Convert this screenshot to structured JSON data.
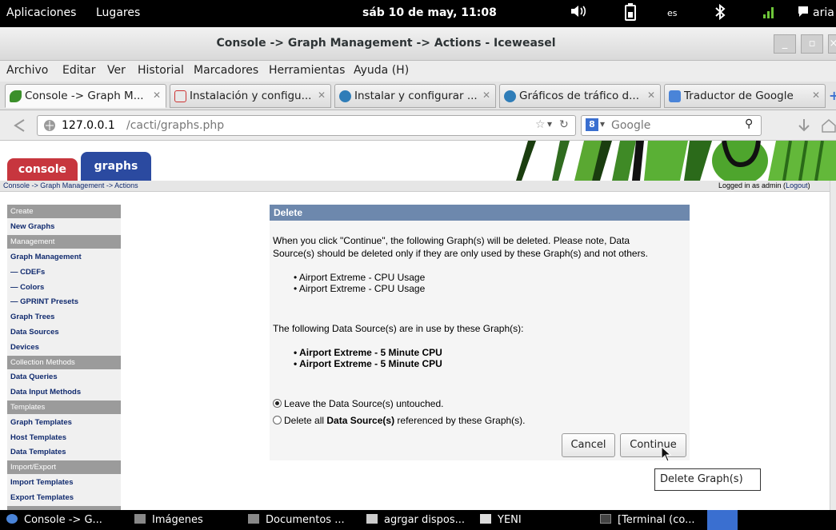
{
  "topbar": {
    "applications": "Aplicaciones",
    "places": "Lugares",
    "clock": "sáb 10 de may, 11:08",
    "lang": "es",
    "user": "aria"
  },
  "window": {
    "title": "Console -> Graph Management -> Actions - Iceweasel"
  },
  "menu": {
    "items": [
      "Archivo",
      "Editar",
      "Ver",
      "Historial",
      "Marcadores",
      "Herramientas",
      "Ayuda (H)"
    ]
  },
  "tabs": [
    {
      "label": "Console -> Graph M...",
      "icon": "cacti-icon"
    },
    {
      "label": "Instalación y configu...",
      "icon": "page-icon"
    },
    {
      "label": "Instalar y configurar ...",
      "icon": "wordpress-icon"
    },
    {
      "label": "Gráficos de tráfico d...",
      "icon": "wordpress-icon"
    },
    {
      "label": "Traductor de Google",
      "icon": "translate-icon"
    }
  ],
  "nav": {
    "url_host": "127.0.0.1",
    "url_path": "/cacti/graphs.php",
    "search_placeholder": "Google"
  },
  "cacti": {
    "tab_console": "console",
    "tab_graphs": "graphs",
    "breadcrumb": "Console -> Graph Management -> Actions",
    "logged_in_prefix": "Logged in as admin (",
    "logout": "Logout",
    "logged_in_suffix": ")"
  },
  "sidebar": {
    "items": [
      {
        "label": "Create",
        "type": "header"
      },
      {
        "label": "New Graphs",
        "type": "link"
      },
      {
        "label": "Management",
        "type": "header"
      },
      {
        "label": "Graph Management",
        "type": "link"
      },
      {
        "label": "— CDEFs",
        "type": "link"
      },
      {
        "label": "— Colors",
        "type": "link"
      },
      {
        "label": "— GPRINT Presets",
        "type": "link"
      },
      {
        "label": "Graph Trees",
        "type": "link"
      },
      {
        "label": "Data Sources",
        "type": "link"
      },
      {
        "label": "Devices",
        "type": "link"
      },
      {
        "label": "Collection Methods",
        "type": "header"
      },
      {
        "label": "Data Queries",
        "type": "link"
      },
      {
        "label": "Data Input Methods",
        "type": "link"
      },
      {
        "label": "Templates",
        "type": "header"
      },
      {
        "label": "Graph Templates",
        "type": "link"
      },
      {
        "label": "Host Templates",
        "type": "link"
      },
      {
        "label": "Data Templates",
        "type": "link"
      },
      {
        "label": "Import/Export",
        "type": "header"
      },
      {
        "label": "Import Templates",
        "type": "link"
      },
      {
        "label": "Export Templates",
        "type": "link"
      }
    ]
  },
  "dialog": {
    "title": "Delete",
    "intro_line1": "When you click \"Continue\", the following Graph(s) will be deleted. Please note, Data",
    "intro_line2": "Source(s) should be deleted only if they are only used by these Graph(s) and not others.",
    "graphs": [
      "Airport Extreme - CPU Usage",
      "Airport Extreme - CPU Usage"
    ],
    "ds_intro": "The following Data Source(s) are in use by these Graph(s):",
    "data_sources": [
      "Airport Extreme - 5 Minute CPU",
      "Airport Extreme - 5 Minute CPU"
    ],
    "option_leave": "Leave the Data Source(s) untouched.",
    "option_delete_pre": "Delete all ",
    "option_delete_bold": "Data Source(s)",
    "option_delete_post": " referenced by these Graph(s).",
    "cancel": "Cancel",
    "continue": "Continue",
    "tooltip": "Delete Graph(s)"
  },
  "taskbar": [
    {
      "label": "Console -> G..."
    },
    {
      "label": "Imágenes"
    },
    {
      "label": "Documentos ..."
    },
    {
      "label": "agrgar dispos..."
    },
    {
      "label": "YENI"
    },
    {
      "label": "[Terminal (co..."
    }
  ]
}
